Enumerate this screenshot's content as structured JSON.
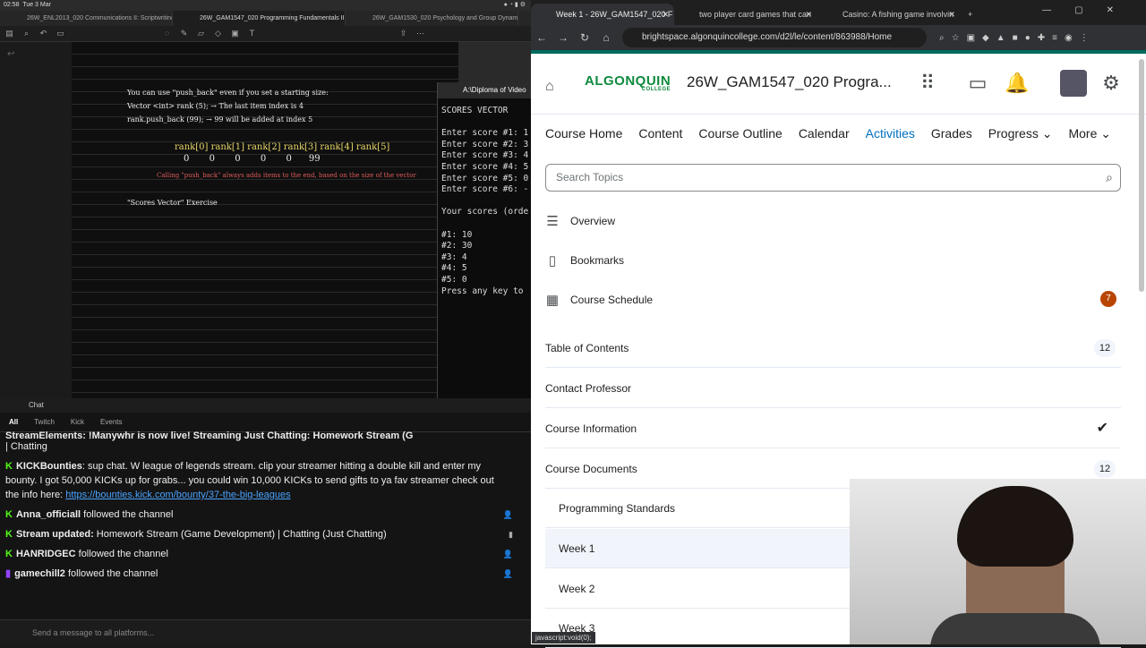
{
  "mac_bar": {
    "time": "02:58",
    "date": "Tue 3 Mar"
  },
  "notes_tabs": [
    {
      "label": "26W_ENL2013_020 Communications II: Scriptwriting",
      "active": false
    },
    {
      "label": "26W_GAM1547_020 Programming Fundamentals II",
      "active": true
    },
    {
      "label": "26W_GAM1530_020 Psychology and Group Dynamics",
      "active": false
    }
  ],
  "notes": {
    "line1": "You can use \"push_back\" even if you set a starting size:",
    "line2": "Vector <int> rank (5); → The last item index is 4",
    "line3": "rank.push_back (99); → 99 will be added at index 5",
    "indices": "rank[0] rank[1] rank[2] rank[3] rank[4] rank[5]",
    "values": "0       0       0       0       0      99",
    "note_red": "Calling \"push_back\" always adds items to the end, based on the size of the vector",
    "exercise": "\"Scores Vector\" Exercise"
  },
  "console": {
    "title": "A:\\Diploma of Video",
    "text": "SCORES VECTOR\n\nEnter score #1: 1\nEnter score #2: 3\nEnter score #3: 4\nEnter score #4: 5\nEnter score #5: 0\nEnter score #6: -\n\nYour scores (orde\n\n#1: 10\n#2: 30\n#3: 4\n#4: 5\n#5: 0\nPress any key to"
  },
  "chat": {
    "header": "Chat",
    "tabs": [
      "All",
      "Twitch",
      "Kick",
      "Events"
    ],
    "partial_top": "StreamElements: !Manywhr is now live! Streaming Just Chatting: Homework Stream (G",
    "partial_top2": "| Chatting",
    "messages": [
      {
        "user": "KICKBounties",
        "text": ": sup chat. W league of legends stream. clip your streamer hitting a double kill and enter my bounty. I got 50,000 KICKs up for grabs... you could win 10,000 KICKs to send gifts to ya fav streamer check out the info here: ",
        "link": "https://bounties.kick.com/bounty/37-the-big-leagues"
      },
      {
        "user": "Anna_officiall",
        "text": " followed the channel",
        "link": ""
      },
      {
        "user": "Stream updated:",
        "text": " Homework Stream (Game Development) | Chatting (Just Chatting)",
        "link": ""
      },
      {
        "user": "HANRIDGEC",
        "text": " followed the channel",
        "link": ""
      },
      {
        "user": "gamechill2",
        "text": " followed the channel",
        "link": ""
      }
    ],
    "input_placeholder": "Send a message to all platforms..."
  },
  "chrome": {
    "tabs": [
      {
        "label": "Week 1 - 26W_GAM1547_020 F",
        "active": true
      },
      {
        "label": "two player card games that can",
        "active": false
      },
      {
        "label": "Casino: A fishing game involvin",
        "active": false
      }
    ],
    "url": "brightspace.algonquincollege.com/d2l/le/content/863988/Home",
    "status_tip": "javascript:void(0);"
  },
  "brightspace": {
    "logo": "ALGONQUIN",
    "logo_sub": "COLLEGE",
    "course_title": "26W_GAM1547_020 Progra...",
    "nav": [
      "Course Home",
      "Content",
      "Course Outline",
      "Calendar",
      "Activities",
      "Grades",
      "Progress",
      "More"
    ],
    "search_placeholder": "Search Topics",
    "overview": "Overview",
    "bookmarks": "Bookmarks",
    "schedule": "Course Schedule",
    "schedule_badge": "7",
    "toc": [
      {
        "label": "Table of Contents",
        "count": "12"
      },
      {
        "label": "Contact Professor",
        "count": ""
      },
      {
        "label": "Course Information",
        "count": ""
      },
      {
        "label": "Course Documents",
        "count": "12"
      },
      {
        "label": "Programming Standards",
        "count": ""
      },
      {
        "label": "Week 1",
        "count": ""
      },
      {
        "label": "Week 2",
        "count": ""
      },
      {
        "label": "Week 3",
        "count": ""
      }
    ],
    "accent": "#006fbf",
    "brand": "#006b5f"
  }
}
